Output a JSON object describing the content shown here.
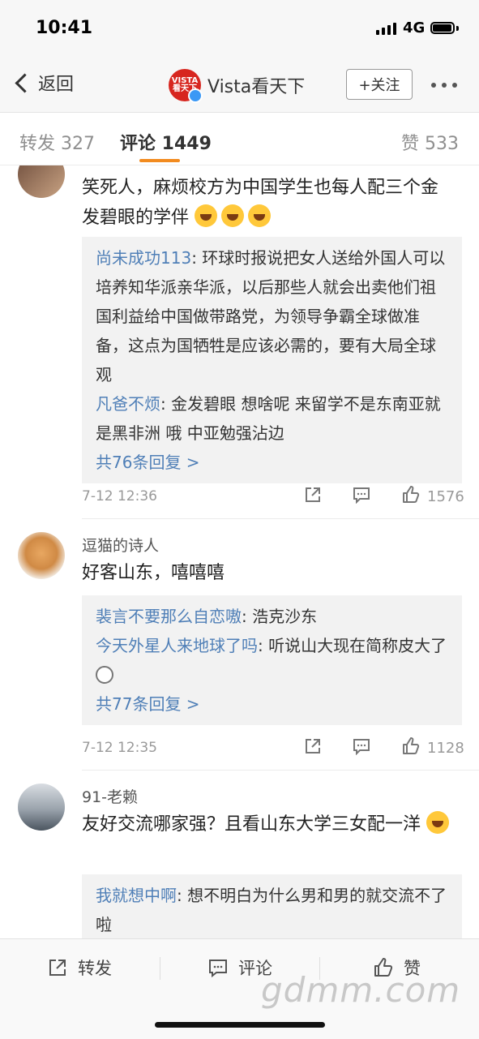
{
  "status_bar": {
    "time": "10:41",
    "network": "4G"
  },
  "nav": {
    "back_label": "返回",
    "account_name": "Vista看天下",
    "avatar_text_1": "VISTA",
    "avatar_text_2": "看天下",
    "follow_label": "+关注"
  },
  "tabs": [
    {
      "label": "转发 327"
    },
    {
      "label": "评论 1449",
      "active": true
    },
    {
      "label": "赞 533"
    }
  ],
  "comments": [
    {
      "text": "笑死人，麻烦校方为中国学生也每人配三个金发碧眼的学伴",
      "emoji_count": 3,
      "replies": [
        {
          "user": "尚未成功113",
          "text": ": 环球时报说把女人送给外国人可以培养知华派亲华派，以后那些人就会出卖他们祖国利益给中国做带路党，为领导争霸全球做准备，这点为国牺牲是应该必需的，要有大局全球观"
        },
        {
          "user": "凡爸不烦",
          "text": ": 金发碧眼 想啥呢  来留学不是东南亚就是黑非洲  哦 中亚勉强沾边"
        }
      ],
      "more_replies": "共76条回复 >",
      "date": "7-12 12:36",
      "likes": "1576"
    },
    {
      "user": "逗猫的诗人",
      "text": "好客山东，嘻嘻嘻",
      "replies": [
        {
          "user": "裴言不要那么自恋嗷",
          "text": ": 浩克沙东"
        },
        {
          "user": "今天外星人来地球了吗",
          "text": ": 听说山大现在简称皮大了"
        }
      ],
      "more_replies": "共77条回复 >",
      "date": "7-12 12:35",
      "likes": "1128"
    },
    {
      "user": "91-老赖",
      "text": "友好交流哪家强？且看山东大学三女配一洋",
      "replies": [
        {
          "user": "我就想中啊",
          "text": ": 想不明白为什么男和男的就交流不了啦"
        }
      ]
    }
  ],
  "bottom_bar": {
    "share_label": "转发",
    "comment_label": "评论",
    "like_label": "赞"
  },
  "watermark": "gdmm.com"
}
